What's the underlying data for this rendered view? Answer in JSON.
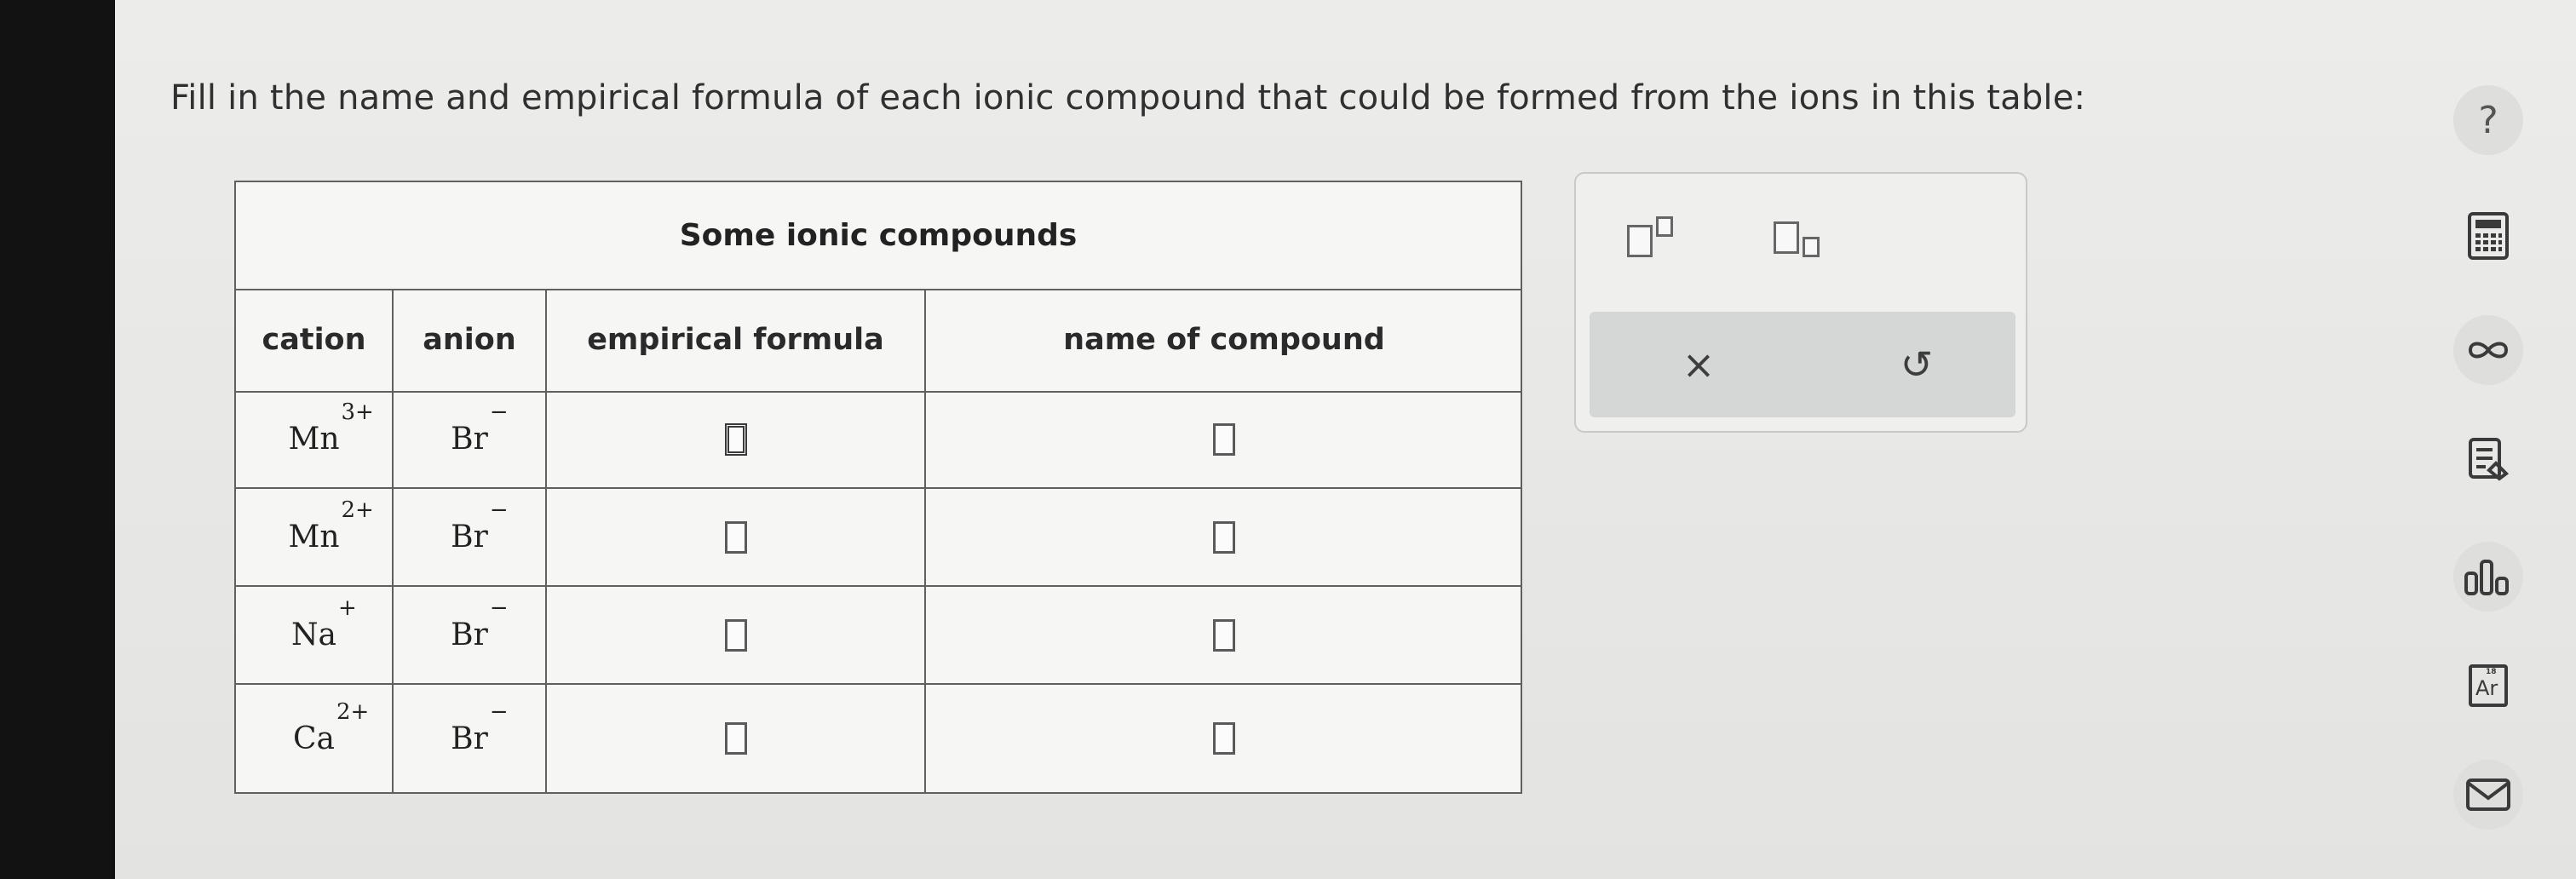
{
  "prompt": "Fill in the name and empirical formula of each ionic compound that could be formed from the ions in this table:",
  "table": {
    "title": "Some ionic compounds",
    "headers": {
      "cation": "cation",
      "anion": "anion",
      "formula": "empirical formula",
      "name": "name of compound"
    },
    "rows": [
      {
        "cation": "Mn",
        "cation_charge": "3+",
        "anion": "Br",
        "anion_charge": "−",
        "formula_value": "",
        "name_value": ""
      },
      {
        "cation": "Mn",
        "cation_charge": "2+",
        "anion": "Br",
        "anion_charge": "−",
        "formula_value": "",
        "name_value": ""
      },
      {
        "cation": "Na",
        "cation_charge": "+",
        "anion": "Br",
        "anion_charge": "−",
        "formula_value": "",
        "name_value": ""
      },
      {
        "cation": "Ca",
        "cation_charge": "2+",
        "anion": "Br",
        "anion_charge": "−",
        "formula_value": "",
        "name_value": ""
      }
    ]
  },
  "palette": {
    "buttons": [
      "superscript-template",
      "subscript-template"
    ],
    "actions": {
      "clear": "×",
      "undo": "↺"
    }
  },
  "sidebar": {
    "icons": [
      "question-icon",
      "calculator-icon",
      "infinity-icon",
      "notes-icon",
      "chart-icon",
      "periodic-table-icon",
      "mail-icon"
    ],
    "question_label": "?",
    "periodic_label": "Ar",
    "periodic_number": "18"
  }
}
